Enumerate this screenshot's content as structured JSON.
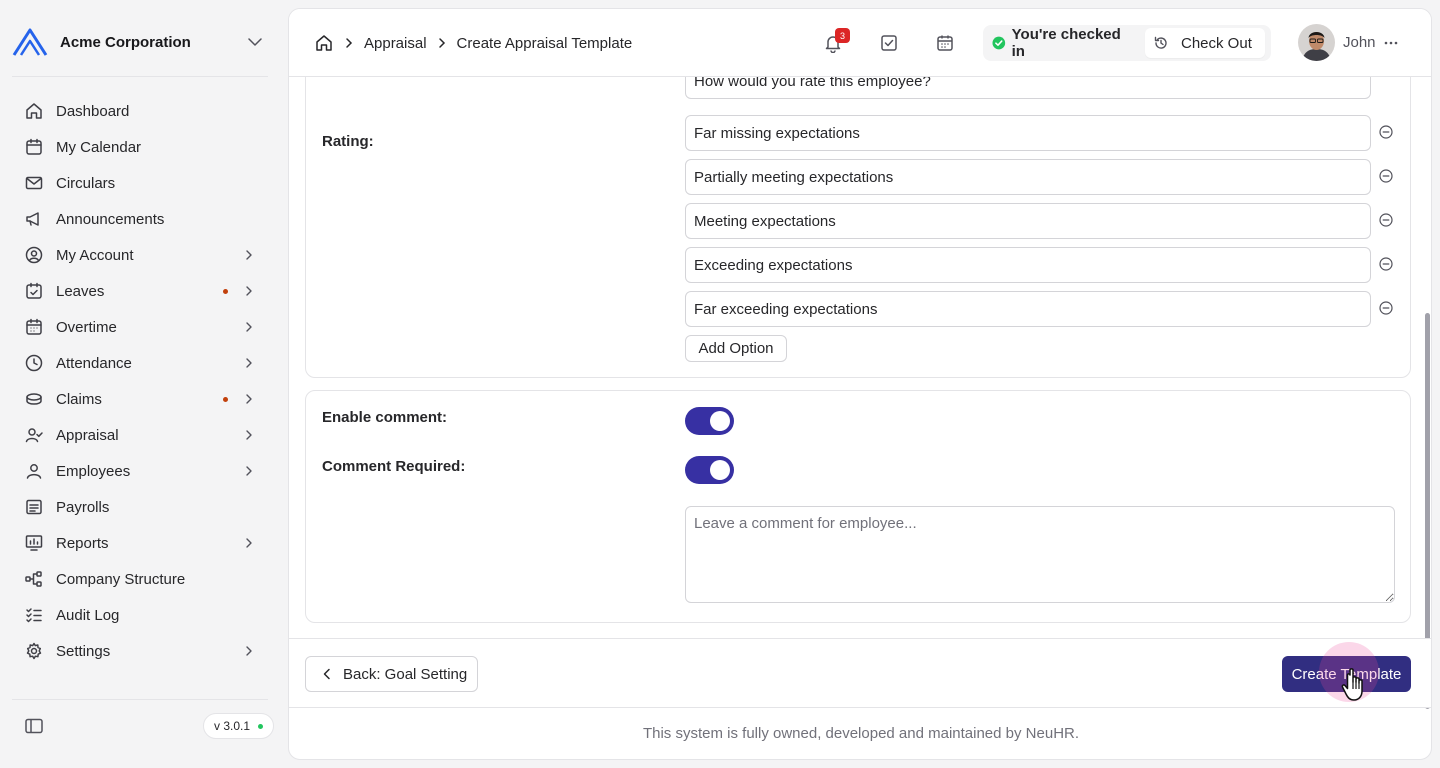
{
  "org": {
    "name": "Acme Corporation"
  },
  "sidebar": {
    "items": [
      {
        "label": "Dashboard",
        "icon": "home-icon",
        "has_dot": false,
        "has_arrow": false
      },
      {
        "label": "My Calendar",
        "icon": "calendar-icon",
        "has_dot": false,
        "has_arrow": false
      },
      {
        "label": "Circulars",
        "icon": "mail-icon",
        "has_dot": false,
        "has_arrow": false
      },
      {
        "label": "Announcements",
        "icon": "megaphone-icon",
        "has_dot": false,
        "has_arrow": false
      },
      {
        "label": "My Account",
        "icon": "user-circle-icon",
        "has_dot": false,
        "has_arrow": true
      },
      {
        "label": "Leaves",
        "icon": "calendar-check-icon",
        "has_dot": true,
        "has_arrow": true
      },
      {
        "label": "Overtime",
        "icon": "calendar-clock-icon",
        "has_dot": false,
        "has_arrow": true
      },
      {
        "label": "Attendance",
        "icon": "clock-icon",
        "has_dot": false,
        "has_arrow": true
      },
      {
        "label": "Claims",
        "icon": "coins-icon",
        "has_dot": true,
        "has_arrow": true
      },
      {
        "label": "Appraisal",
        "icon": "user-check-icon",
        "has_dot": false,
        "has_arrow": true
      },
      {
        "label": "Employees",
        "icon": "user-icon",
        "has_dot": false,
        "has_arrow": true
      },
      {
        "label": "Payrolls",
        "icon": "receipt-icon",
        "has_dot": false,
        "has_arrow": false
      },
      {
        "label": "Reports",
        "icon": "chart-icon",
        "has_dot": false,
        "has_arrow": true
      },
      {
        "label": "Company Structure",
        "icon": "hierarchy-icon",
        "has_dot": false,
        "has_arrow": false
      },
      {
        "label": "Audit Log",
        "icon": "list-check-icon",
        "has_dot": false,
        "has_arrow": false
      },
      {
        "label": "Settings",
        "icon": "gear-icon",
        "has_dot": false,
        "has_arrow": true
      }
    ],
    "version": "v 3.0.1"
  },
  "header": {
    "breadcrumbs": [
      "Appraisal",
      "Create Appraisal Template"
    ],
    "notification_count": "3",
    "checkin_status": "You're checked in",
    "checkout_label": "Check Out",
    "user_name": "John"
  },
  "form": {
    "question_value": "How would you rate this employee?",
    "rating_label": "Rating:",
    "rating_options": [
      "Far missing expectations",
      "Partially meeting expectations",
      "Meeting expectations",
      "Exceeding expectations",
      "Far exceeding expectations"
    ],
    "add_option_label": "Add Option",
    "enable_comment_label": "Enable comment:",
    "enable_comment_on": true,
    "comment_required_label": "Comment Required:",
    "comment_required_on": true,
    "comment_placeholder": "Leave a comment for employee..."
  },
  "footer": {
    "back_label": "Back: Goal Setting",
    "create_label": "Create Template",
    "copyright": "This system is fully owned, developed and maintained by NeuHR."
  },
  "colors": {
    "primary": "#312e81",
    "toggle": "#3730a3",
    "status_ok": "#22c55e",
    "badge": "#dc2626",
    "alert_dot": "#c2410c"
  }
}
